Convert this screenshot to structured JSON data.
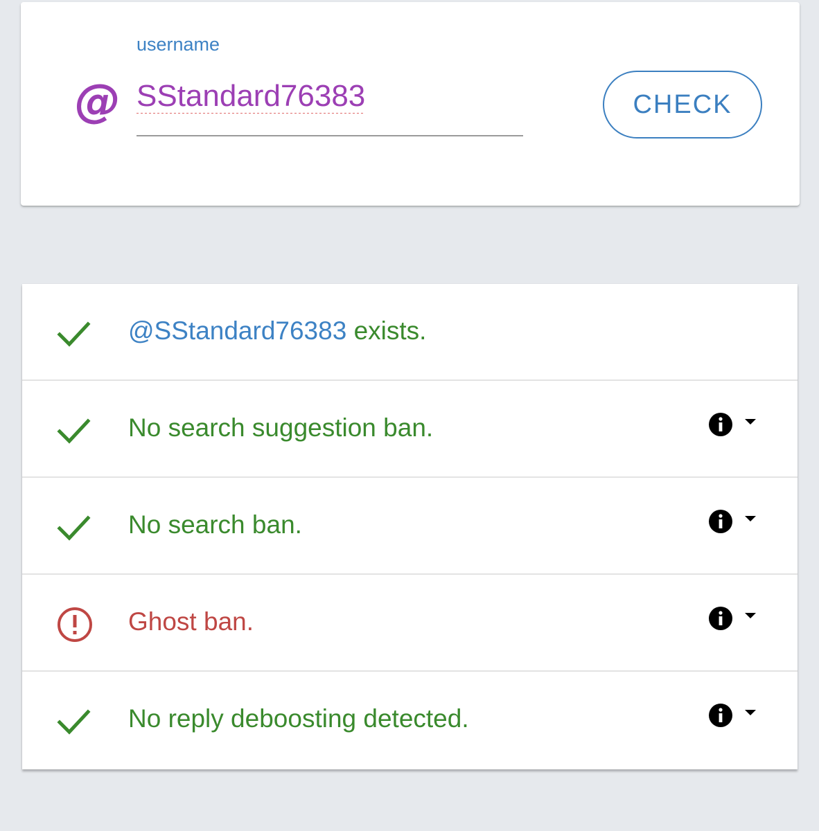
{
  "search": {
    "label": "username",
    "at_symbol": "@",
    "value": "SStandard76383",
    "check_button": "CHECK"
  },
  "colors": {
    "accent_blue": "#3b7fc0",
    "purple": "#9c3fb4",
    "success_green": "#3a8a2d",
    "error_red": "#bf4744",
    "background": "#e6e9ed"
  },
  "results": {
    "exists": {
      "status": "ok",
      "icon": "check-icon",
      "handle": "@SStandard76383",
      "suffix": " exists."
    },
    "suggestion_ban": {
      "status": "ok",
      "icon": "check-icon",
      "text": "No search suggestion ban."
    },
    "search_ban": {
      "status": "ok",
      "icon": "check-icon",
      "text": "No search ban."
    },
    "ghost_ban": {
      "status": "error",
      "icon": "alert-circle-icon",
      "text": "Ghost ban."
    },
    "reply_deboosting": {
      "status": "ok",
      "icon": "check-icon",
      "text": "No reply deboosting detected."
    }
  }
}
